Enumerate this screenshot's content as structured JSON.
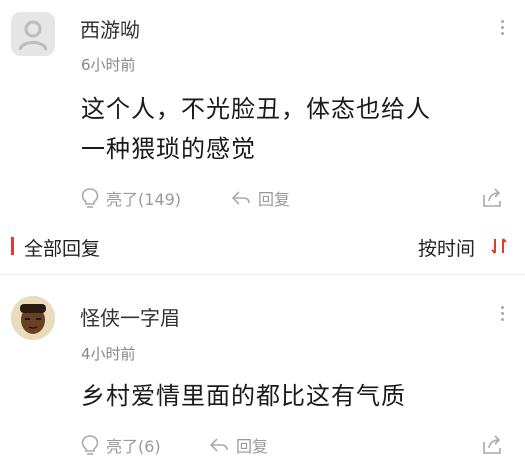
{
  "comments": [
    {
      "username": "西游呦",
      "time": "6小时前",
      "content_lines": [
        "这个人，不光脸丑，体态也给人",
        "一种猥琐的感觉"
      ],
      "like_label": "亮了(149)",
      "reply_label": "回复"
    },
    {
      "username": "怪侠一字眉",
      "time": "4小时前",
      "content_lines": [
        "乡村爱情里面的都比这有气质"
      ],
      "like_label": "亮了(6)",
      "reply_label": "回复"
    }
  ],
  "section": {
    "title": "全部回复",
    "sort_label": "按时间"
  },
  "colors": {
    "accent": "#e23c2b",
    "secondary_text": "#999999"
  },
  "icons": [
    "default-avatar-icon",
    "more-icon",
    "like-bulb-icon",
    "reply-arrow-icon",
    "share-icon",
    "sort-icon"
  ]
}
